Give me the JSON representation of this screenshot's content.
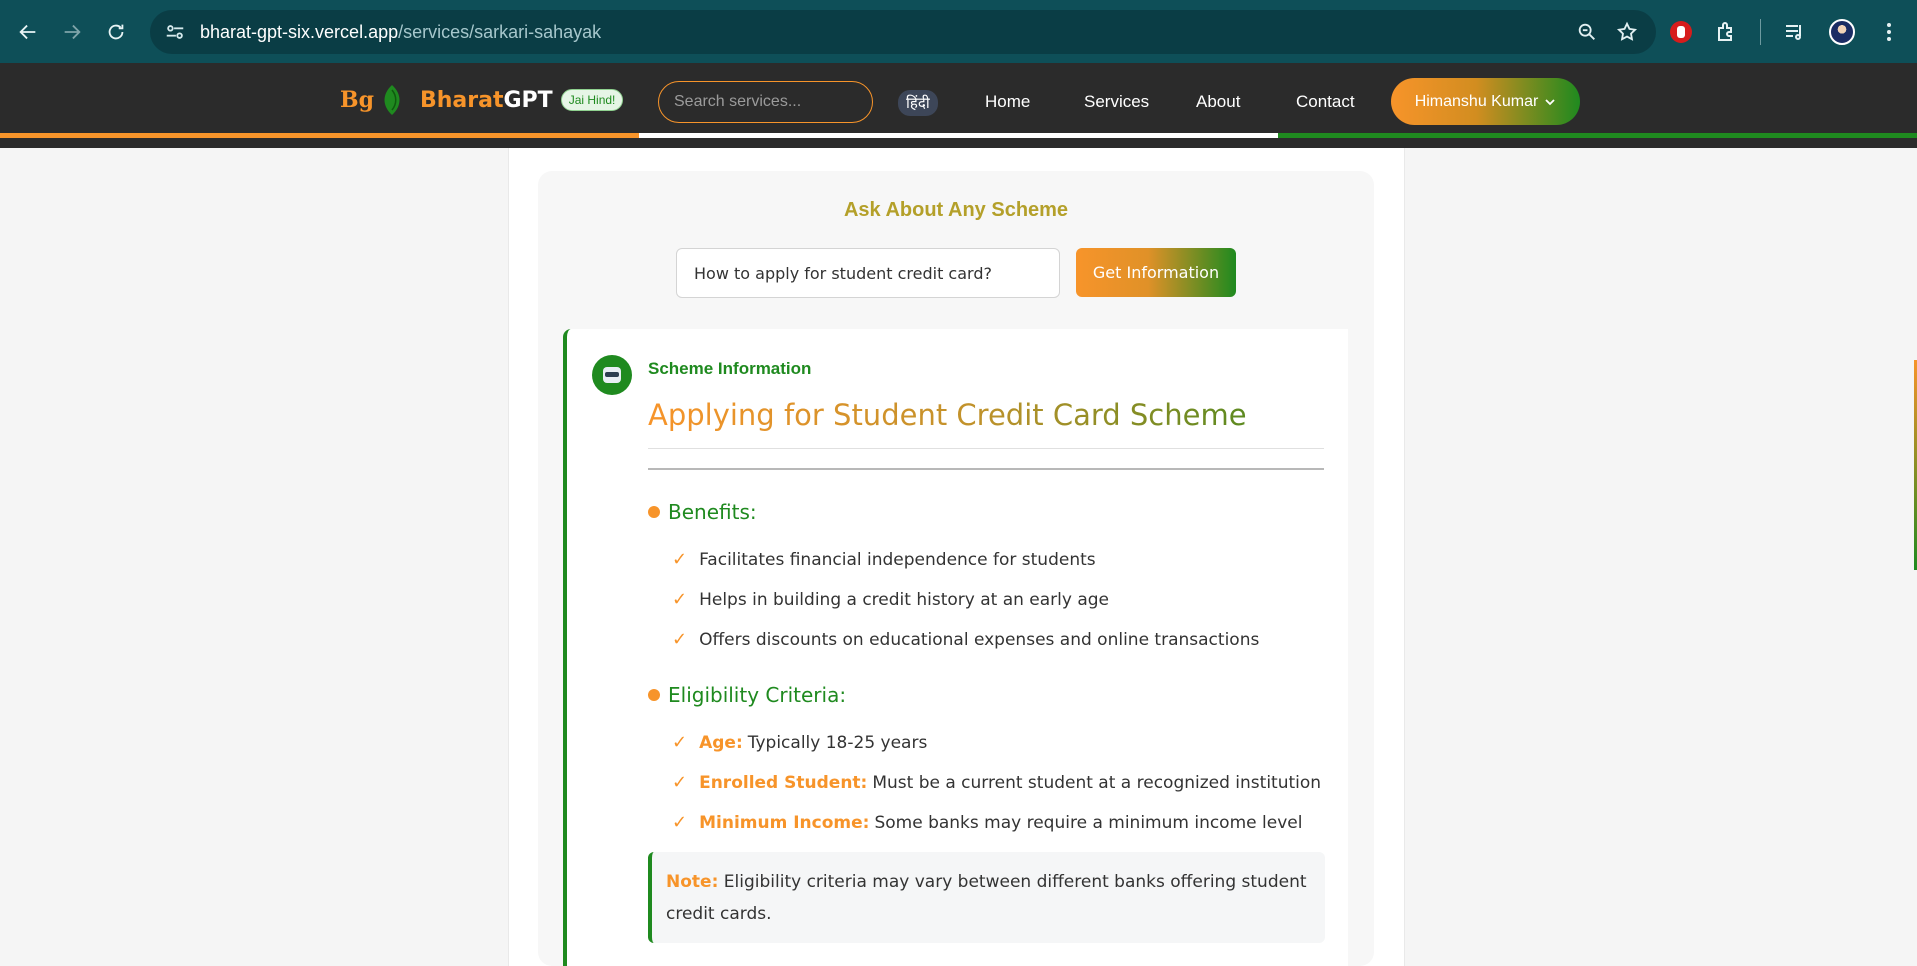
{
  "browser": {
    "url_host": "bharat-gpt-six.vercel.app",
    "url_path": "/services/sarkari-sahayak"
  },
  "header": {
    "logo_mark": "Bg",
    "brand_first": "Bharat",
    "brand_second": "GPT",
    "badge": "Jai Hind!",
    "search_placeholder": "Search services...",
    "lang_toggle": "हिंदी",
    "nav": [
      "Home",
      "Services",
      "About",
      "Contact"
    ],
    "user_name": "Himanshu Kumar",
    "tricolor": [
      "#f7942a",
      "#ffffff",
      "#1f8a1f"
    ]
  },
  "ask": {
    "title": "Ask About Any Scheme",
    "query": "How to apply for student credit card?",
    "button": "Get Information"
  },
  "result": {
    "label": "Scheme Information",
    "title": "Applying for Student Credit Card Scheme",
    "benefits": {
      "heading": "Benefits:",
      "items": [
        "Facilitates financial independence for students",
        "Helps in building a credit history at an early age",
        "Offers discounts on educational expenses and online transactions"
      ]
    },
    "eligibility": {
      "heading": "Eligibility Criteria:",
      "items": [
        {
          "label": "Age:",
          "text": "Typically 18-25 years"
        },
        {
          "label": "Enrolled Student:",
          "text": "Must be a current student at a recognized institution"
        },
        {
          "label": "Minimum Income:",
          "text": "Some banks may require a minimum income level"
        }
      ]
    },
    "note": {
      "label": "Note:",
      "text": "Eligibility criteria may vary between different banks offering student credit cards."
    }
  },
  "colors": {
    "saffron": "#f7942a",
    "green": "#1f8a1f",
    "header_bg": "#2b2b2b",
    "chrome_bg": "#0e4f58"
  }
}
